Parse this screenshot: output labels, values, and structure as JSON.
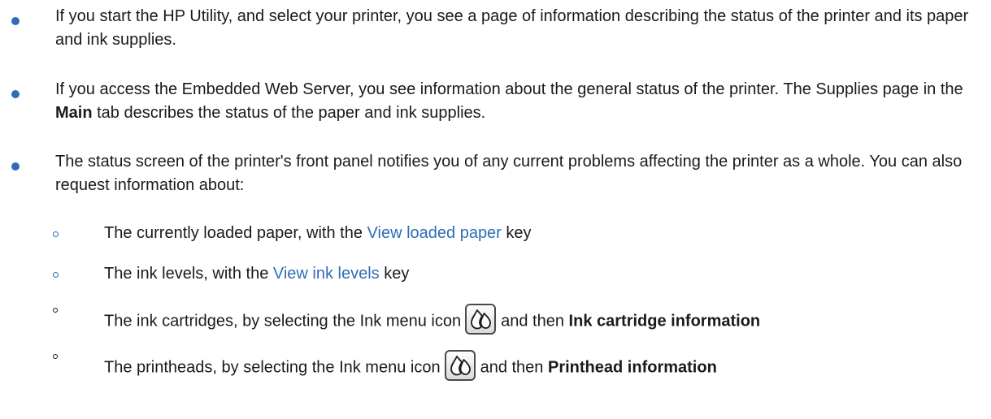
{
  "bullets": [
    {
      "text": "If you start the HP Utility, and select your printer, you see a page of information describing the status of the printer and its paper and ink supplies."
    },
    {
      "text_before": "If you access the Embedded Web Server, you see information about the general status of the printer. The Supplies page in the ",
      "bold": "Main",
      "text_after": " tab describes the status of the paper and ink supplies."
    },
    {
      "text": "The status screen of the printer's front panel notifies you of any current problems affecting the printer as a whole. You can also request information about:"
    }
  ],
  "sub_items": [
    {
      "text_before": "The currently loaded paper, with the ",
      "link": "View loaded paper",
      "text_after": " key"
    },
    {
      "text_before": "The ink levels, with the ",
      "link": "View ink levels",
      "text_after": " key"
    },
    {
      "text_before": "The ink cartridges, by selecting the Ink menu icon",
      "icon": "ink-drops-icon",
      "text_middle": "and then ",
      "bold": "Ink cartridge information"
    },
    {
      "text_before": "The printheads, by selecting the Ink menu icon",
      "icon": "ink-drops-icon",
      "text_middle": "and then ",
      "bold": "Printhead information"
    }
  ],
  "colors": {
    "accent": "#2e6db4",
    "text": "#1a1a1a"
  }
}
